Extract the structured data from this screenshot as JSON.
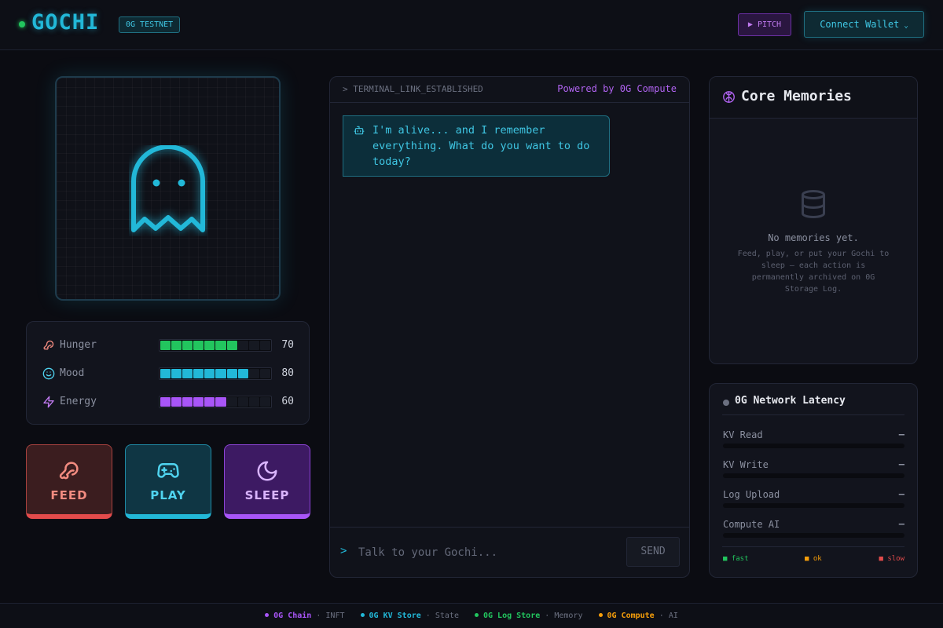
{
  "header": {
    "logo": "GOCHI",
    "network_badge": "0G TESTNET",
    "pitch_label": "▶ PITCH",
    "wallet_label": "Connect Wallet",
    "status_color": "#22c55e"
  },
  "pet": {
    "icon": "ghost-icon",
    "color": "#22b8d8"
  },
  "stats": [
    {
      "label": "Hunger",
      "value": 70,
      "icon": "drumstick-icon",
      "color": "#22c55e"
    },
    {
      "label": "Mood",
      "value": 80,
      "icon": "smile-icon",
      "color": "#22b8d8"
    },
    {
      "label": "Energy",
      "value": 60,
      "icon": "lightning-icon",
      "color": "#a855f7"
    }
  ],
  "actions": {
    "feed": "FEED",
    "play": "PLAY",
    "sleep": "SLEEP"
  },
  "terminal": {
    "title": "> TERMINAL_LINK_ESTABLISHED",
    "powered_by": "Powered by 0G Compute",
    "message": "I'm alive... and I remember everything. What do you want to do today?",
    "prompt": ">",
    "input_placeholder": "Talk to your Gochi...",
    "send_label": "SEND"
  },
  "memories": {
    "title": "Core Memories",
    "empty_title": "No memories yet.",
    "empty_desc": "Feed, play, or put your Gochi to sleep — each action is permanently archived on 0G Storage Log."
  },
  "latency": {
    "title": "0G Network Latency",
    "rows": [
      {
        "name": "KV Read",
        "value": "—"
      },
      {
        "name": "KV Write",
        "value": "—"
      },
      {
        "name": "Log Upload",
        "value": "—"
      },
      {
        "name": "Compute AI",
        "value": "—"
      }
    ],
    "legend": {
      "fast": "■ fast",
      "ok": "■ ok",
      "slow": "■ slow"
    }
  },
  "footer": [
    {
      "name": "0G Chain",
      "sep": "·",
      "role": "INFT",
      "color": "#a855f7"
    },
    {
      "name": "0G KV Store",
      "sep": "·",
      "role": "State",
      "color": "#22b8d8"
    },
    {
      "name": "0G Log Store",
      "sep": "·",
      "role": "Memory",
      "color": "#22c55e"
    },
    {
      "name": "0G Compute",
      "sep": "·",
      "role": "AI",
      "color": "#f59e0b"
    }
  ]
}
